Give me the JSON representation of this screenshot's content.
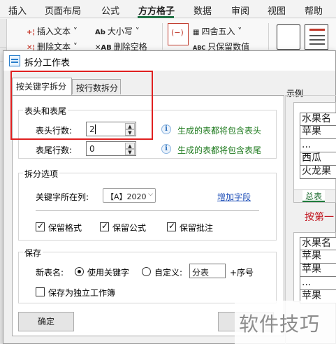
{
  "menubar": {
    "tabs": [
      "插入",
      "页面布局",
      "公式",
      "方方格子",
      "数据",
      "审阅",
      "视图",
      "帮助"
    ],
    "active_tab": "方方格子"
  },
  "ribbon": {
    "insert_text": "插入文本",
    "delete_text": "删除文本",
    "case": "大小写",
    "delete_space": "删除空格",
    "round": "四舍五入",
    "keep_values": "只保留数值"
  },
  "dialog": {
    "title": "拆分工作表",
    "tabs": [
      "按关键字拆分",
      "按行数拆分"
    ],
    "header_footer": {
      "title": "表头和表尾",
      "header_rows_label": "表头行数:",
      "header_rows_value": "2",
      "header_hint": "生成的表都将包含表头",
      "footer_rows_label": "表尾行数:",
      "footer_rows_value": "0",
      "footer_hint": "生成的表都将包含表尾"
    },
    "split_options": {
      "title": "拆分选项",
      "key_column_label": "关键字所在列:",
      "key_column_value": "【A】2020",
      "add_field_link": "增加字段",
      "keep_format": "保留格式",
      "keep_formula": "保留公式",
      "keep_comment": "保留批注"
    },
    "save": {
      "title": "保存",
      "new_name_label": "新表名:",
      "use_keyword": "使用关键字",
      "custom": "自定义:",
      "custom_value": "分表",
      "seq_suffix": "+序号",
      "save_as_workbook": "保存为独立工作簿"
    },
    "ok_button": "确定"
  },
  "preview": {
    "label": "示例",
    "sheet1": {
      "rows": [
        "水果名",
        "苹果",
        "...",
        "西瓜",
        "火龙果"
      ],
      "tab": "总表"
    },
    "note": "按第一",
    "sheet2": {
      "rows": [
        "水果名",
        "苹果",
        "苹果",
        "...",
        "苹果"
      ]
    }
  },
  "watermark": "软件技巧"
}
